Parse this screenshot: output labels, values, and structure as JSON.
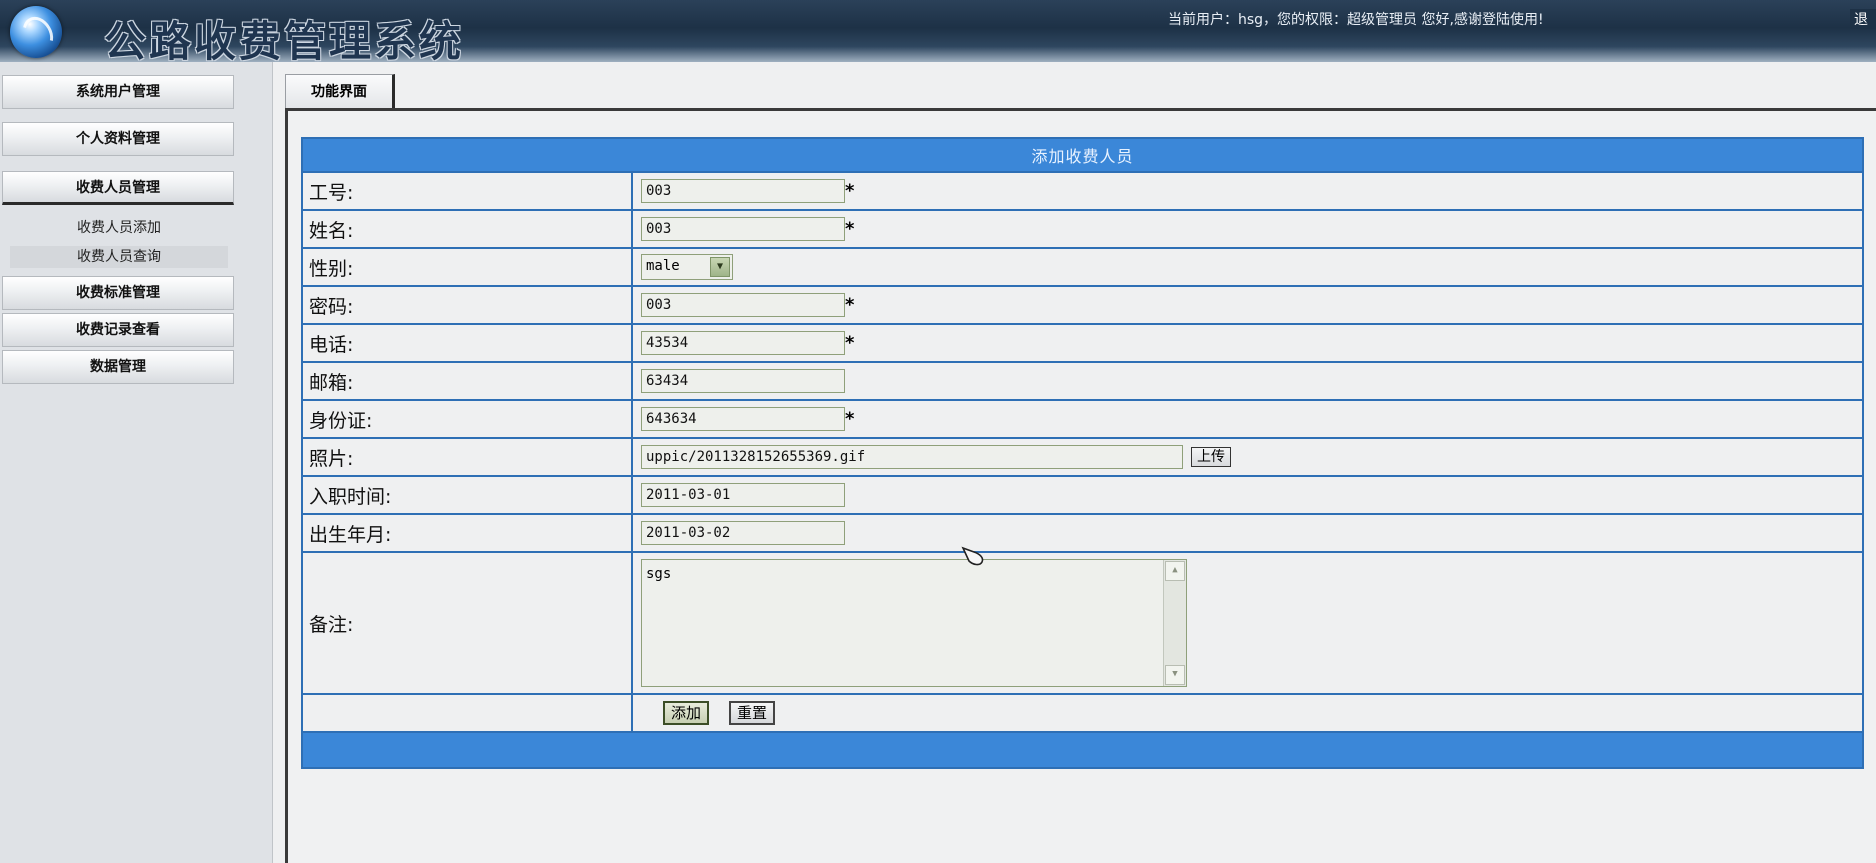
{
  "header": {
    "title": "公路收费管理系统",
    "user_info": "当前用户：hsg，您的权限：超级管理员  您好,感谢登陆使用!",
    "logout": "退"
  },
  "sidebar": {
    "menus": [
      {
        "label": "系统用户管理"
      },
      {
        "label": "个人资料管理"
      },
      {
        "label": "收费人员管理"
      },
      {
        "label": "收费标准管理"
      },
      {
        "label": "收费记录查看"
      },
      {
        "label": "数据管理"
      }
    ],
    "sub_items": [
      {
        "label": "收费人员添加"
      },
      {
        "label": "收费人员查询"
      }
    ]
  },
  "tab": {
    "label": "功能界面"
  },
  "form": {
    "title": "添加收费人员",
    "required_mark": "*",
    "fields": {
      "employee_id": {
        "label": "工号:",
        "value": "003"
      },
      "name": {
        "label": "姓名:",
        "value": "003"
      },
      "gender": {
        "label": "性别:",
        "value": "male"
      },
      "password": {
        "label": "密码:",
        "value": "003"
      },
      "phone": {
        "label": "电话:",
        "value": "43534"
      },
      "email": {
        "label": "邮箱:",
        "value": "63434"
      },
      "id_card": {
        "label": "身份证:",
        "value": "643634"
      },
      "photo": {
        "label": "照片:",
        "value": "uppic/2011328152655369.gif",
        "upload_label": "上传"
      },
      "hire_date": {
        "label": "入职时间:",
        "value": "2011-03-01"
      },
      "birth_date": {
        "label": "出生年月:",
        "value": "2011-03-02"
      },
      "remark": {
        "label": "备注:",
        "value": "sgs"
      }
    },
    "buttons": {
      "add": "添加",
      "reset": "重置"
    }
  }
}
